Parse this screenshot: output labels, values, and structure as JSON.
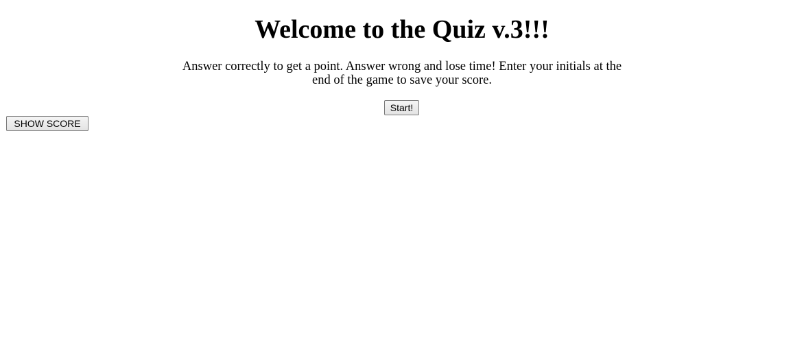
{
  "header": {
    "title": "Welcome to the Quiz v.3!!!",
    "instructions": "Answer correctly to get a point. Answer wrong and lose time! Enter your initials at the end of the game to save your score."
  },
  "controls": {
    "start_label": "Start!",
    "show_score_label": "SHOW SCORE"
  }
}
